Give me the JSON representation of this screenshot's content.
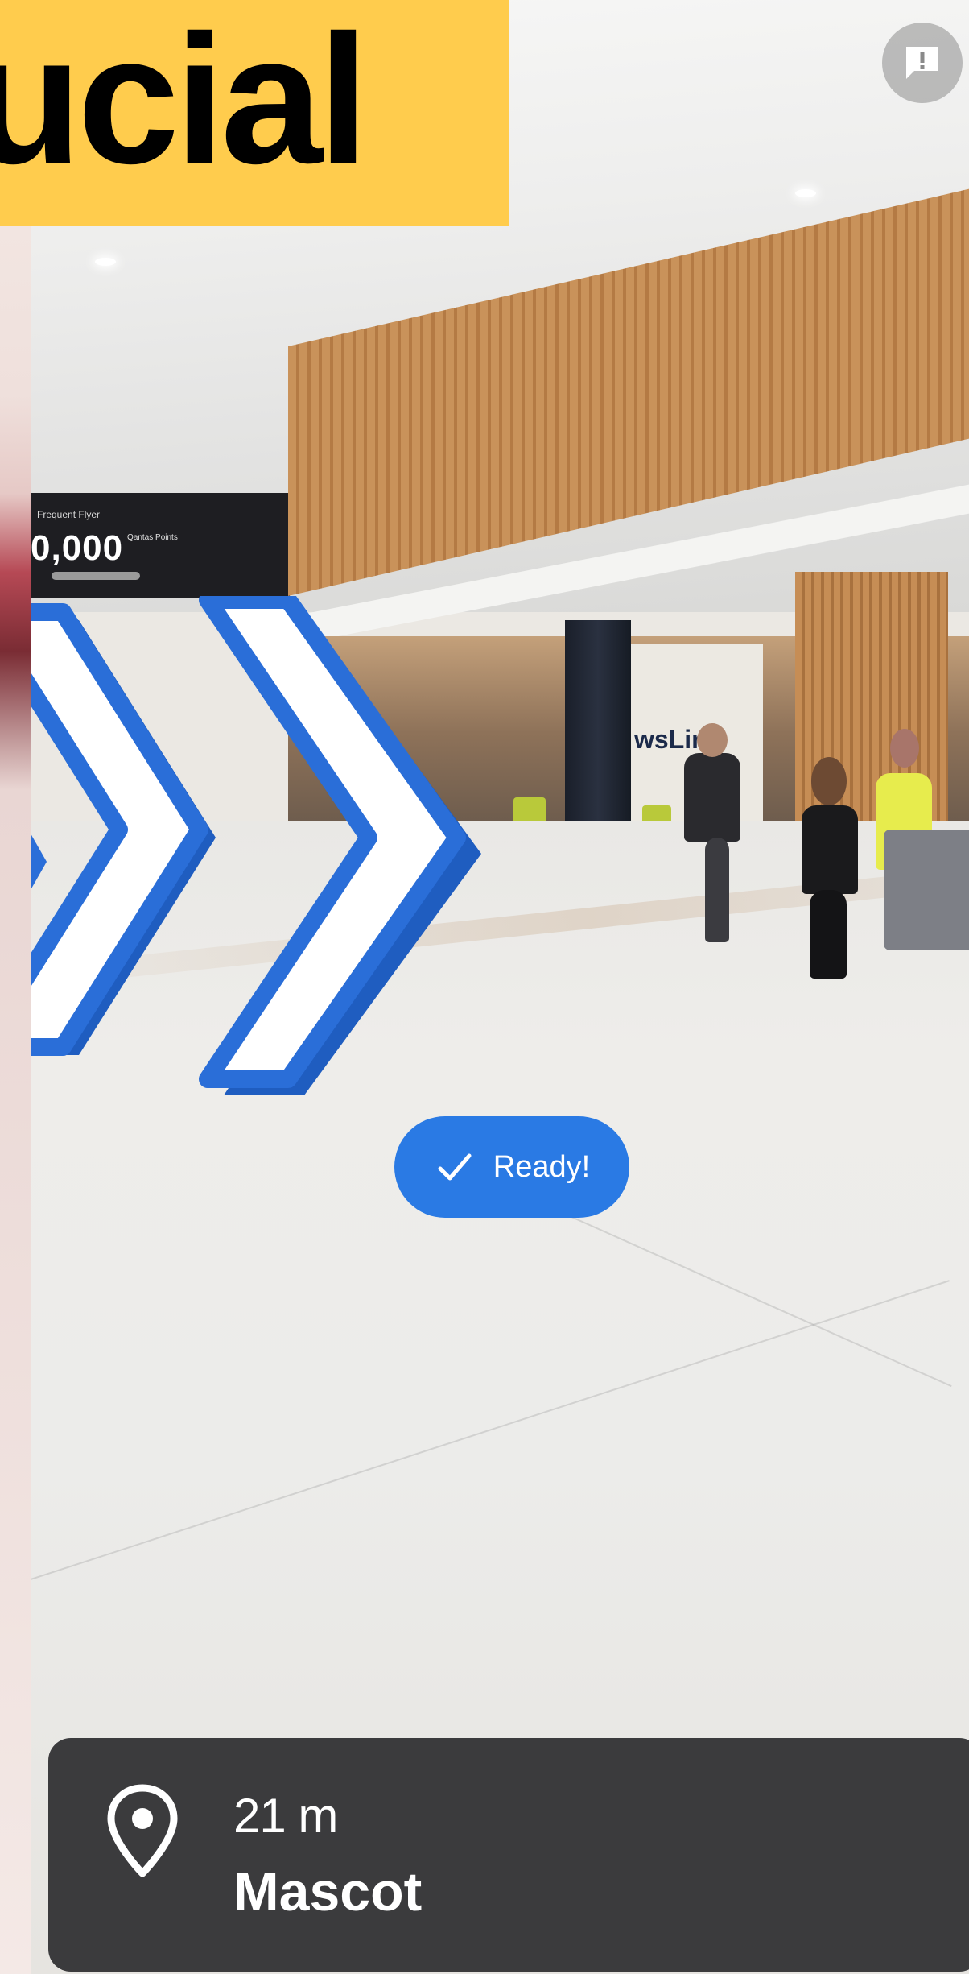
{
  "banner": {
    "text": "rucial"
  },
  "billboard": {
    "top_text": "Frequent Flyer",
    "amount": "0,000",
    "sub_text": "Qantas Points"
  },
  "shop": {
    "sign": "wsLin"
  },
  "status": {
    "label": "Ready!",
    "color": "#2a7ae4"
  },
  "feedback": {
    "icon": "feedback-icon"
  },
  "navigation": {
    "distance": "21 m",
    "destination": "Mascot",
    "icon": "location-pin-icon"
  },
  "colors": {
    "banner_bg": "#ffcc4d",
    "arrow_blue": "#2a6ed8",
    "card_bg": "#3b3b3d"
  }
}
